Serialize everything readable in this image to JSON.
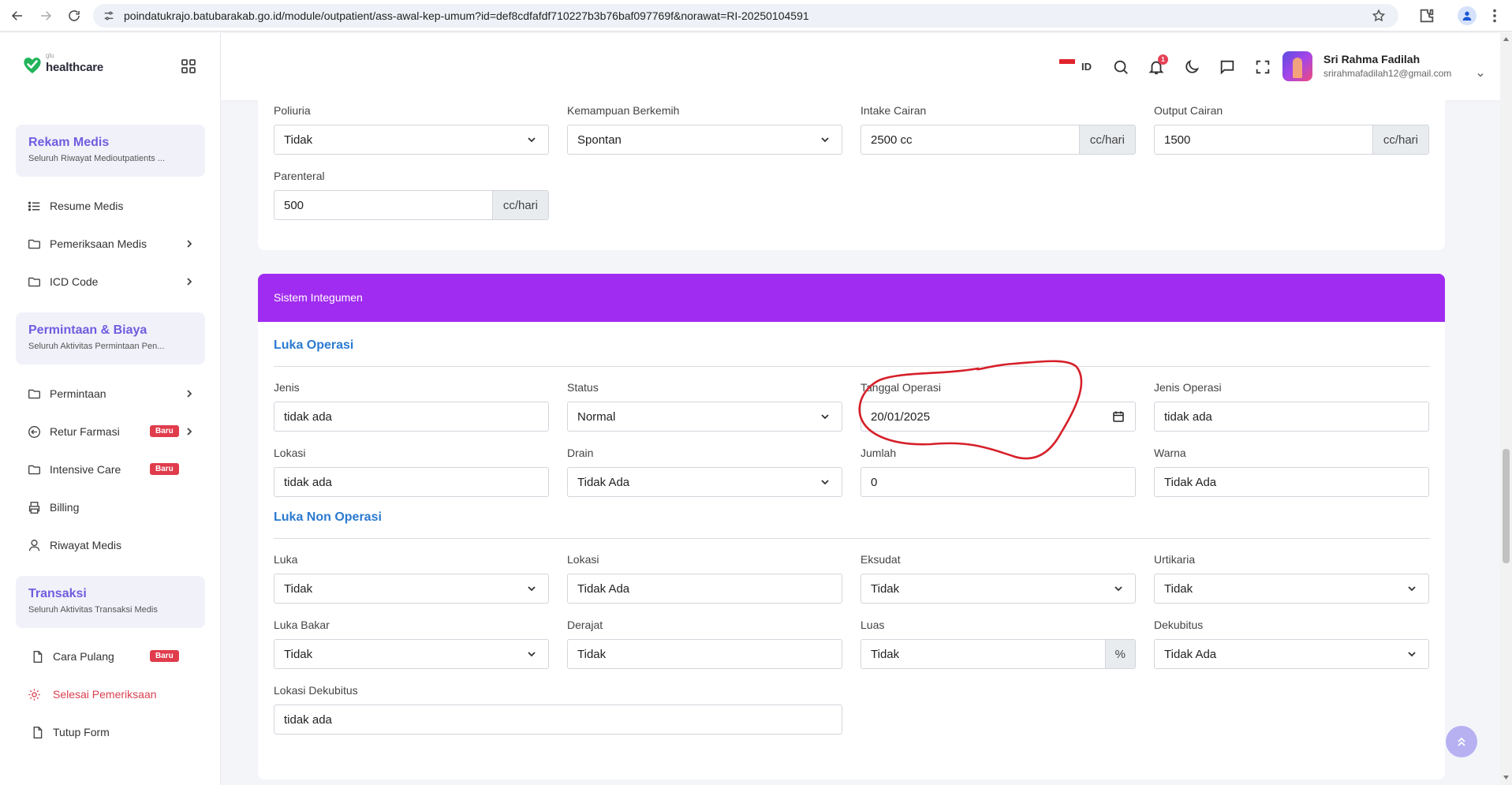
{
  "browser": {
    "url": "poindatukrajo.batubarakab.go.id/module/outpatient/ass-awal-kep-umum?id=def8cdfafdf710227b3b76baf097769f&norawat=RI-20250104591"
  },
  "brand": {
    "logo_small": "glu",
    "logo_text": "healthcare"
  },
  "sidebar": {
    "sections": [
      {
        "title": "Rekam Medis",
        "subtitle": "Seluruh Riwayat Medioutpatients ..."
      },
      {
        "title": "Permintaan & Biaya",
        "subtitle": "Seluruh Aktivitas Permintaan Pen..."
      },
      {
        "title": "Transaksi",
        "subtitle": "Seluruh Aktivitas Transaksi Medis"
      }
    ],
    "items": [
      {
        "label": "Resume Medis",
        "icon": "list-icon"
      },
      {
        "label": "Pemeriksaan Medis",
        "icon": "folder-icon"
      },
      {
        "label": "ICD Code",
        "icon": "folder-icon"
      },
      {
        "label": "Permintaan",
        "icon": "folder-icon"
      },
      {
        "label": "Retur Farmasi",
        "icon": "return-icon",
        "badge": "Baru"
      },
      {
        "label": "Intensive Care",
        "icon": "folder-icon",
        "badge": "Baru"
      },
      {
        "label": "Billing",
        "icon": "printer-icon"
      },
      {
        "label": "Riwayat Medis",
        "icon": "user-icon"
      },
      {
        "label": "Cara Pulang",
        "icon": "file-icon",
        "badge": "Baru"
      },
      {
        "label": "Selesai Pemeriksaan",
        "icon": "gear-icon"
      },
      {
        "label": "Tutup Form",
        "icon": "file-icon"
      }
    ]
  },
  "header": {
    "lang": "ID",
    "notif_count": "1",
    "user_name": "Sri Rahma Fadilah",
    "user_email": "srirahmafadilah12@gmail.com"
  },
  "form_top": {
    "poliuria": {
      "label": "Poliuria",
      "value": "Tidak"
    },
    "kemampuan_berkemih": {
      "label": "Kemampuan Berkemih",
      "value": "Spontan"
    },
    "intake_cairan": {
      "label": "Intake Cairan",
      "value": "2500 cc",
      "unit": "cc/hari"
    },
    "output_cairan": {
      "label": "Output Cairan",
      "value": "1500",
      "unit": "cc/hari"
    },
    "parenteral": {
      "label": "Parenteral",
      "value": "500",
      "unit": "cc/hari"
    }
  },
  "integumen": {
    "header": "Sistem Integumen",
    "luka_operasi": {
      "title": "Luka Operasi",
      "jenis": {
        "label": "Jenis",
        "value": "tidak ada"
      },
      "status": {
        "label": "Status",
        "value": "Normal"
      },
      "tanggal_operasi": {
        "label": "Tanggal Operasi",
        "value": "20/01/2025"
      },
      "jenis_operasi": {
        "label": "Jenis Operasi",
        "value": "tidak ada"
      },
      "lokasi": {
        "label": "Lokasi",
        "value": "tidak ada"
      },
      "drain": {
        "label": "Drain",
        "value": "Tidak Ada"
      },
      "jumlah": {
        "label": "Jumlah",
        "value": "0"
      },
      "warna": {
        "label": "Warna",
        "value": "Tidak Ada"
      }
    },
    "luka_non_operasi": {
      "title": "Luka Non Operasi",
      "luka": {
        "label": "Luka",
        "value": "Tidak"
      },
      "lokasi": {
        "label": "Lokasi",
        "value": "Tidak Ada"
      },
      "eksudat": {
        "label": "Eksudat",
        "value": "Tidak"
      },
      "urtikaria": {
        "label": "Urtikaria",
        "value": "Tidak"
      },
      "luka_bakar": {
        "label": "Luka Bakar",
        "value": "Tidak"
      },
      "derajat": {
        "label": "Derajat",
        "value": "Tidak"
      },
      "luas": {
        "label": "Luas",
        "value": "Tidak",
        "unit": "%"
      },
      "dekubitus": {
        "label": "Dekubitus",
        "value": "Tidak Ada"
      },
      "lokasi_dekubitus": {
        "label": "Lokasi Dekubitus",
        "value": "tidak ada"
      }
    }
  },
  "colors": {
    "accent_purple": "#a12cf1",
    "section_blue": "#2b7ad1",
    "badge_red": "#e03c4c",
    "annotation_red": "#d6202a"
  }
}
